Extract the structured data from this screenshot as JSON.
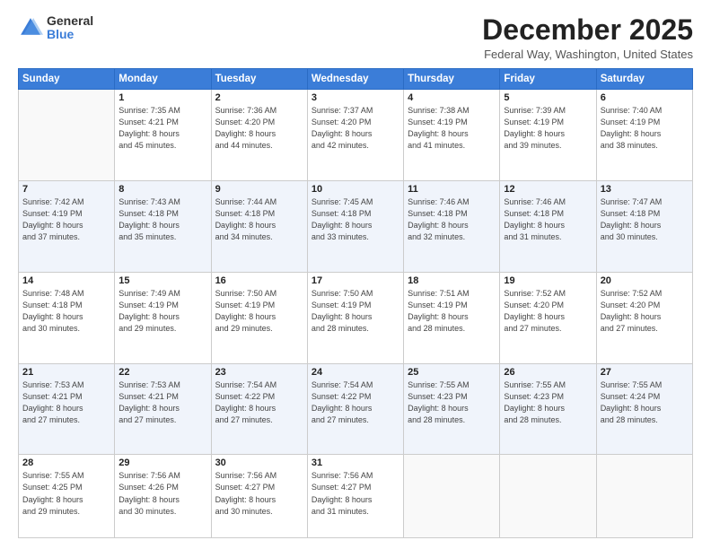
{
  "logo": {
    "general": "General",
    "blue": "Blue"
  },
  "header": {
    "month": "December 2025",
    "location": "Federal Way, Washington, United States"
  },
  "days": [
    "Sunday",
    "Monday",
    "Tuesday",
    "Wednesday",
    "Thursday",
    "Friday",
    "Saturday"
  ],
  "weeks": [
    [
      {
        "day": "",
        "info": ""
      },
      {
        "day": "1",
        "info": "Sunrise: 7:35 AM\nSunset: 4:21 PM\nDaylight: 8 hours\nand 45 minutes."
      },
      {
        "day": "2",
        "info": "Sunrise: 7:36 AM\nSunset: 4:20 PM\nDaylight: 8 hours\nand 44 minutes."
      },
      {
        "day": "3",
        "info": "Sunrise: 7:37 AM\nSunset: 4:20 PM\nDaylight: 8 hours\nand 42 minutes."
      },
      {
        "day": "4",
        "info": "Sunrise: 7:38 AM\nSunset: 4:19 PM\nDaylight: 8 hours\nand 41 minutes."
      },
      {
        "day": "5",
        "info": "Sunrise: 7:39 AM\nSunset: 4:19 PM\nDaylight: 8 hours\nand 39 minutes."
      },
      {
        "day": "6",
        "info": "Sunrise: 7:40 AM\nSunset: 4:19 PM\nDaylight: 8 hours\nand 38 minutes."
      }
    ],
    [
      {
        "day": "7",
        "info": "Sunrise: 7:42 AM\nSunset: 4:19 PM\nDaylight: 8 hours\nand 37 minutes."
      },
      {
        "day": "8",
        "info": "Sunrise: 7:43 AM\nSunset: 4:18 PM\nDaylight: 8 hours\nand 35 minutes."
      },
      {
        "day": "9",
        "info": "Sunrise: 7:44 AM\nSunset: 4:18 PM\nDaylight: 8 hours\nand 34 minutes."
      },
      {
        "day": "10",
        "info": "Sunrise: 7:45 AM\nSunset: 4:18 PM\nDaylight: 8 hours\nand 33 minutes."
      },
      {
        "day": "11",
        "info": "Sunrise: 7:46 AM\nSunset: 4:18 PM\nDaylight: 8 hours\nand 32 minutes."
      },
      {
        "day": "12",
        "info": "Sunrise: 7:46 AM\nSunset: 4:18 PM\nDaylight: 8 hours\nand 31 minutes."
      },
      {
        "day": "13",
        "info": "Sunrise: 7:47 AM\nSunset: 4:18 PM\nDaylight: 8 hours\nand 30 minutes."
      }
    ],
    [
      {
        "day": "14",
        "info": "Sunrise: 7:48 AM\nSunset: 4:18 PM\nDaylight: 8 hours\nand 30 minutes."
      },
      {
        "day": "15",
        "info": "Sunrise: 7:49 AM\nSunset: 4:19 PM\nDaylight: 8 hours\nand 29 minutes."
      },
      {
        "day": "16",
        "info": "Sunrise: 7:50 AM\nSunset: 4:19 PM\nDaylight: 8 hours\nand 29 minutes."
      },
      {
        "day": "17",
        "info": "Sunrise: 7:50 AM\nSunset: 4:19 PM\nDaylight: 8 hours\nand 28 minutes."
      },
      {
        "day": "18",
        "info": "Sunrise: 7:51 AM\nSunset: 4:19 PM\nDaylight: 8 hours\nand 28 minutes."
      },
      {
        "day": "19",
        "info": "Sunrise: 7:52 AM\nSunset: 4:20 PM\nDaylight: 8 hours\nand 27 minutes."
      },
      {
        "day": "20",
        "info": "Sunrise: 7:52 AM\nSunset: 4:20 PM\nDaylight: 8 hours\nand 27 minutes."
      }
    ],
    [
      {
        "day": "21",
        "info": "Sunrise: 7:53 AM\nSunset: 4:21 PM\nDaylight: 8 hours\nand 27 minutes."
      },
      {
        "day": "22",
        "info": "Sunrise: 7:53 AM\nSunset: 4:21 PM\nDaylight: 8 hours\nand 27 minutes."
      },
      {
        "day": "23",
        "info": "Sunrise: 7:54 AM\nSunset: 4:22 PM\nDaylight: 8 hours\nand 27 minutes."
      },
      {
        "day": "24",
        "info": "Sunrise: 7:54 AM\nSunset: 4:22 PM\nDaylight: 8 hours\nand 27 minutes."
      },
      {
        "day": "25",
        "info": "Sunrise: 7:55 AM\nSunset: 4:23 PM\nDaylight: 8 hours\nand 28 minutes."
      },
      {
        "day": "26",
        "info": "Sunrise: 7:55 AM\nSunset: 4:23 PM\nDaylight: 8 hours\nand 28 minutes."
      },
      {
        "day": "27",
        "info": "Sunrise: 7:55 AM\nSunset: 4:24 PM\nDaylight: 8 hours\nand 28 minutes."
      }
    ],
    [
      {
        "day": "28",
        "info": "Sunrise: 7:55 AM\nSunset: 4:25 PM\nDaylight: 8 hours\nand 29 minutes."
      },
      {
        "day": "29",
        "info": "Sunrise: 7:56 AM\nSunset: 4:26 PM\nDaylight: 8 hours\nand 30 minutes."
      },
      {
        "day": "30",
        "info": "Sunrise: 7:56 AM\nSunset: 4:27 PM\nDaylight: 8 hours\nand 30 minutes."
      },
      {
        "day": "31",
        "info": "Sunrise: 7:56 AM\nSunset: 4:27 PM\nDaylight: 8 hours\nand 31 minutes."
      },
      {
        "day": "",
        "info": ""
      },
      {
        "day": "",
        "info": ""
      },
      {
        "day": "",
        "info": ""
      }
    ]
  ]
}
